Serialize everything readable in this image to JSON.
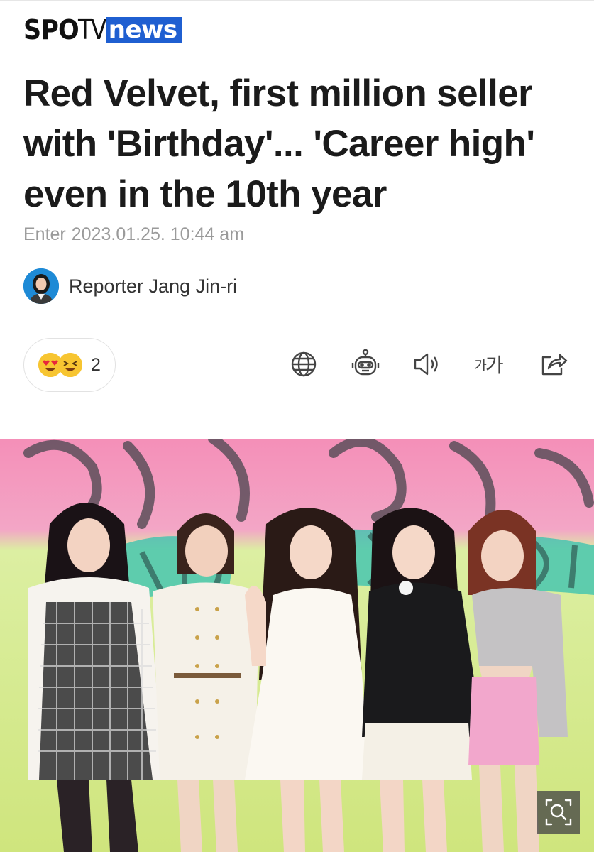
{
  "brand": {
    "part1": "SPO",
    "part2": "TV",
    "part3": "news",
    "accent_color": "#1f5fd1"
  },
  "article": {
    "headline": "Red Velvet, first million seller with 'Birthday'... 'Career high' even in the 10th year",
    "date_label": "Enter",
    "date_value": "2023.01.25. 10:44 am",
    "reporter": "Reporter Jang Jin-ri"
  },
  "reactions": {
    "icons": [
      "heart-eyes-emoji-icon",
      "laughing-emoji-icon"
    ],
    "count": "2"
  },
  "toolbar": {
    "items": [
      "globe-icon",
      "robot-icon",
      "speaker-icon",
      "font-size-icon",
      "share-icon"
    ],
    "font_size_small": "가",
    "font_size_large": "가"
  },
  "photo": {
    "subject": "group-photo",
    "zoom_icon": "zoom-search-icon"
  }
}
